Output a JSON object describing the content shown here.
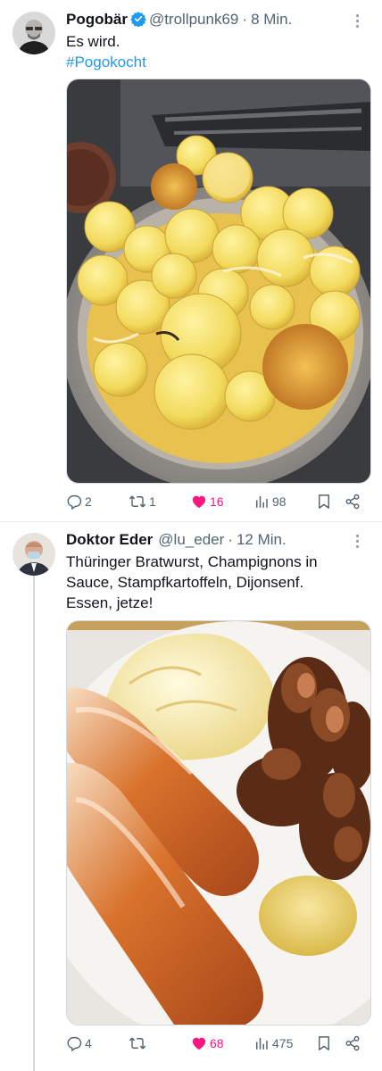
{
  "tweets": [
    {
      "name": "Pogobär",
      "handle": "@trollpunk69",
      "sep": "·",
      "time": "8 Min.",
      "text_line1": "Es wird.",
      "hashtag": "#Pogokocht",
      "stats": {
        "replies": "2",
        "retweets": "1",
        "likes": "16",
        "views": "98"
      }
    },
    {
      "name": "Doktor Eder",
      "handle": "@lu_eder",
      "sep": "·",
      "time": "12 Min.",
      "text_lines": [
        "Thüringer Bratwurst, Champignons in",
        "Sauce, Stampfkartoffeln, Dijonsenf.",
        "Essen, jetze!"
      ],
      "stats": {
        "replies": "4",
        "retweets": "",
        "likes": "68",
        "views": "475"
      }
    }
  ],
  "colors": {
    "accent": "#1d9bf0",
    "like": "#f91880",
    "muted": "#536471",
    "verified": "#1d9bf0"
  }
}
